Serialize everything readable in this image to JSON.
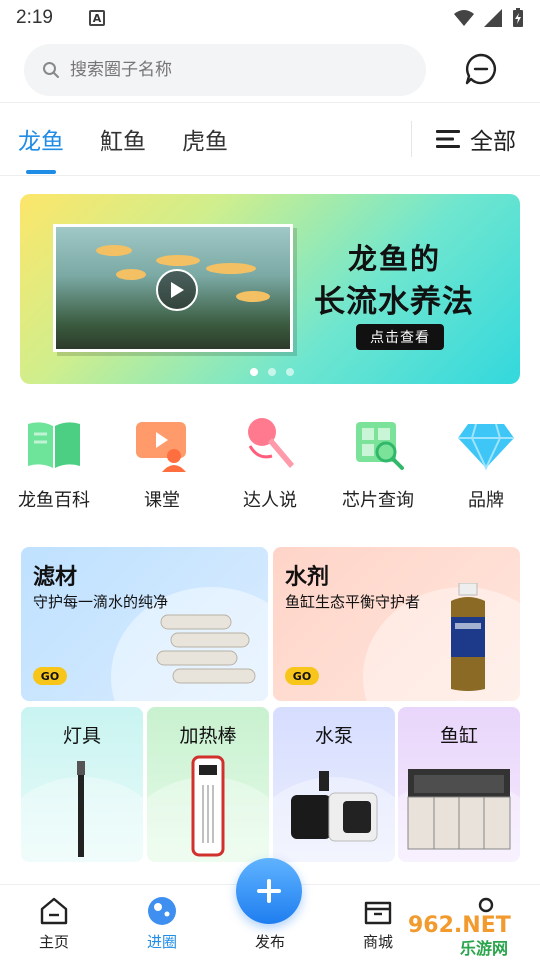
{
  "status_bar": {
    "time": "2:19",
    "badge": "A"
  },
  "search": {
    "placeholder": "搜索圈子名称"
  },
  "tabs": {
    "items": [
      {
        "label": "龙鱼"
      },
      {
        "label": "魟鱼"
      },
      {
        "label": "虎鱼"
      }
    ],
    "all_label": "全部"
  },
  "banner": {
    "title_line1": "龙鱼的",
    "title_line2": "长流水养法",
    "cta": "点击查看",
    "page_count": 3,
    "active_page": 1
  },
  "categories": [
    {
      "label": "龙鱼百科",
      "icon": "book-icon"
    },
    {
      "label": "课堂",
      "icon": "video-class-icon"
    },
    {
      "label": "达人说",
      "icon": "microphone-icon"
    },
    {
      "label": "芯片查询",
      "icon": "chip-search-icon"
    },
    {
      "label": "品牌",
      "icon": "diamond-icon"
    }
  ],
  "featured": [
    {
      "title": "滤材",
      "subtitle": "守护每一滴水的纯净",
      "go": "GO"
    },
    {
      "title": "水剂",
      "subtitle": "鱼缸生态平衡守护者",
      "go": "GO"
    }
  ],
  "products": [
    {
      "title": "灯具"
    },
    {
      "title": "加热棒"
    },
    {
      "title": "水泵"
    },
    {
      "title": "鱼缸"
    }
  ],
  "bottom_nav": [
    {
      "label": "主页",
      "icon": "home-icon"
    },
    {
      "label": "进圈",
      "icon": "circle-icon",
      "active": true
    },
    {
      "label": "发布",
      "icon": "plus-icon"
    },
    {
      "label": "商城",
      "icon": "shop-icon"
    },
    {
      "label": "",
      "icon": "me-icon"
    }
  ],
  "watermark": {
    "text_top": "962.NET",
    "text_bottom": "乐游网"
  },
  "colors": {
    "accent": "#1f8ce6"
  }
}
